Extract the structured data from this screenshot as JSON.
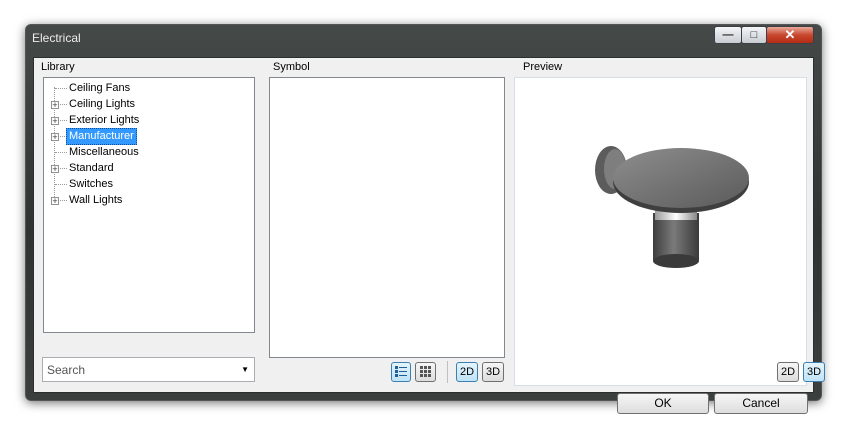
{
  "window": {
    "title": "Electrical",
    "controls": {
      "minimize": "—",
      "maximize": "□",
      "close": "✕"
    }
  },
  "library": {
    "label": "Library",
    "items": [
      {
        "label": "Ceiling Fans",
        "expandable": false,
        "selected": false
      },
      {
        "label": "Ceiling Lights",
        "expandable": true,
        "selected": false
      },
      {
        "label": "Exterior Lights",
        "expandable": true,
        "selected": false
      },
      {
        "label": "Manufacturer",
        "expandable": true,
        "selected": true
      },
      {
        "label": "Miscellaneous",
        "expandable": false,
        "selected": false
      },
      {
        "label": "Standard",
        "expandable": true,
        "selected": false
      },
      {
        "label": "Switches",
        "expandable": false,
        "selected": false
      },
      {
        "label": "Wall Lights",
        "expandable": true,
        "selected": false
      }
    ],
    "search_value": "Search"
  },
  "symbol": {
    "label": "Symbol",
    "btn_2d": "2D",
    "btn_3d": "3D",
    "active_view": "2D",
    "active_list_mode": "list"
  },
  "preview": {
    "label": "Preview",
    "btn_2d": "2D",
    "btn_3d": "3D",
    "active_view": "3D"
  },
  "buttons": {
    "ok": "OK",
    "cancel": "Cancel"
  },
  "colors": {
    "selection": "#3399ff",
    "toggle_active": "#bfe3f7"
  }
}
